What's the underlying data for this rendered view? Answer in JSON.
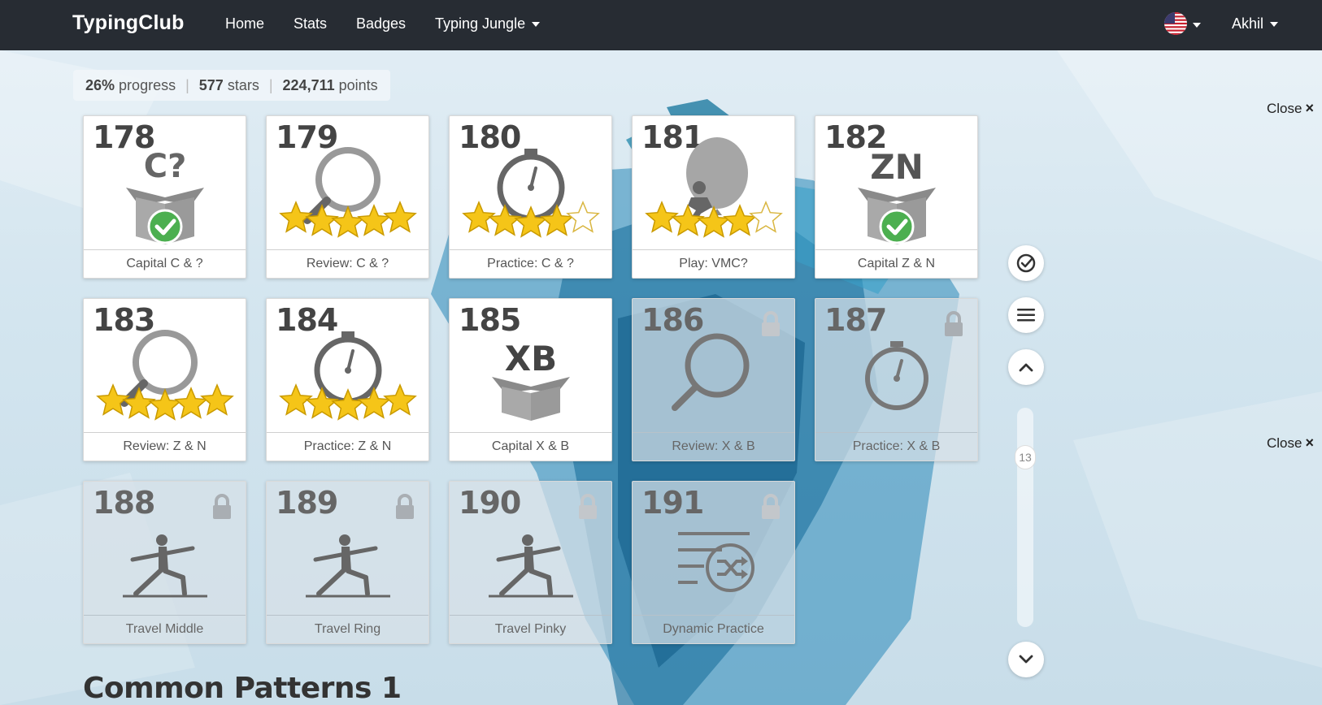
{
  "navbar": {
    "brand": "TypingClub",
    "links": [
      "Home",
      "Stats",
      "Badges",
      "Typing Jungle"
    ],
    "user": "Akhil",
    "flag_icon": "us-flag-icon"
  },
  "summary": {
    "progress_value": "26%",
    "progress_label": "progress",
    "stars_value": "577",
    "stars_label": "stars",
    "points_value": "224,711",
    "points_label": "points"
  },
  "lessons": [
    {
      "num": "178",
      "label": "Capital C & ?",
      "keys": "C?",
      "status": "completed",
      "stars": 0,
      "locked": false
    },
    {
      "num": "179",
      "label": "Review: C & ?",
      "status": "review",
      "stars": 5,
      "locked": false
    },
    {
      "num": "180",
      "label": "Practice: C & ?",
      "status": "practice",
      "stars": 4,
      "locked": false
    },
    {
      "num": "181",
      "label": "Play: VMC?",
      "status": "game",
      "stars": 4,
      "locked": false
    },
    {
      "num": "182",
      "label": "Capital Z & N",
      "keys": "ZN",
      "status": "completed",
      "stars": 0,
      "locked": false
    },
    {
      "num": "183",
      "label": "Review: Z & N",
      "status": "review",
      "stars": 5,
      "locked": false
    },
    {
      "num": "184",
      "label": "Practice: Z & N",
      "status": "practice",
      "stars": 5,
      "locked": false
    },
    {
      "num": "185",
      "label": "Capital X & B",
      "keys": "XB",
      "status": "new",
      "stars": 0,
      "locked": false
    },
    {
      "num": "186",
      "label": "Review: X & B",
      "status": "review",
      "stars": 0,
      "locked": true
    },
    {
      "num": "187",
      "label": "Practice: X & B",
      "status": "practice",
      "stars": 0,
      "locked": true
    },
    {
      "num": "188",
      "label": "Travel Middle",
      "status": "travel",
      "stars": 0,
      "locked": true
    },
    {
      "num": "189",
      "label": "Travel Ring",
      "status": "travel",
      "stars": 0,
      "locked": true
    },
    {
      "num": "190",
      "label": "Travel Pinky",
      "status": "travel",
      "stars": 0,
      "locked": true
    },
    {
      "num": "191",
      "label": "Dynamic Practice",
      "status": "dynamic",
      "stars": 0,
      "locked": true
    }
  ],
  "close_label": "Close",
  "close_symbol": "×",
  "scroll_indicator": "13",
  "section_heading": "Common Patterns 1",
  "side_buttons": [
    "check-circle-icon",
    "menu-icon",
    "chevron-up-icon",
    "chevron-down-icon"
  ],
  "colors": {
    "navbar": "#272c33",
    "star": "#f5c518",
    "check": "#4caf50",
    "accent_blue": "#1f7fa8"
  }
}
